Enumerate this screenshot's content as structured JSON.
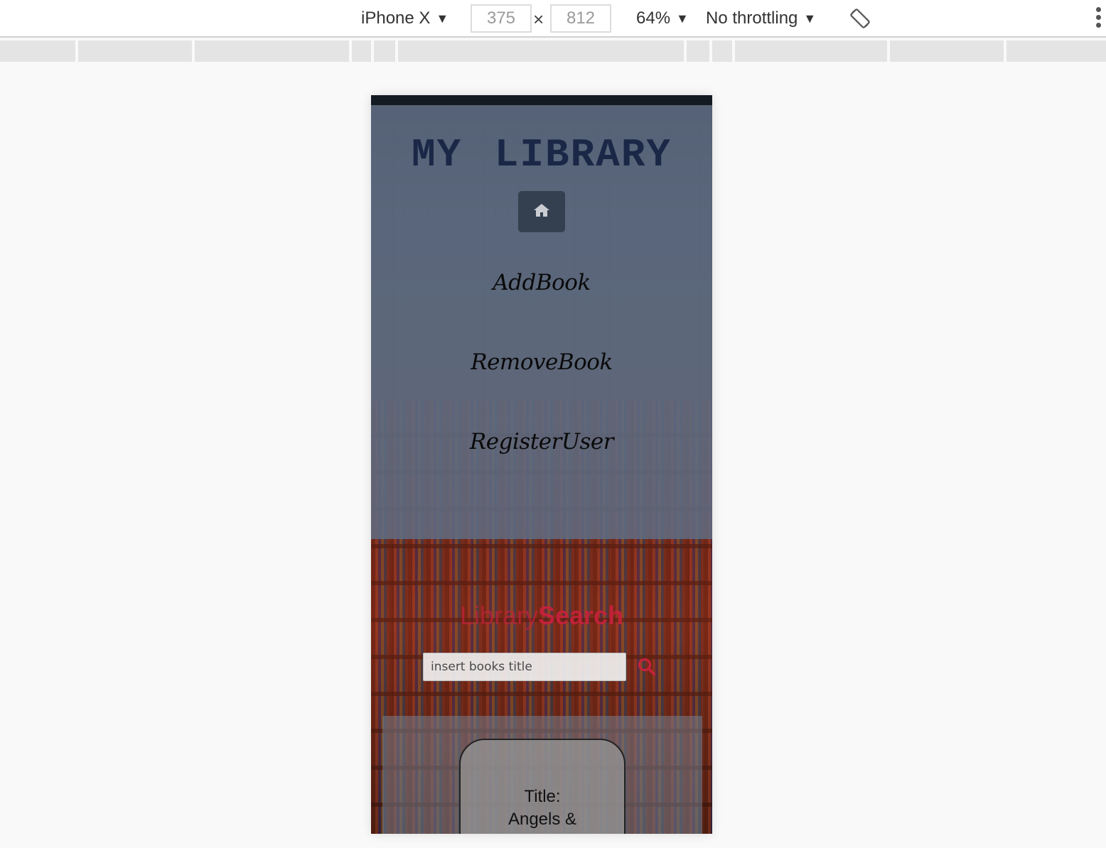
{
  "devtools": {
    "device": "iPhone X",
    "width": "375",
    "height": "812",
    "zoom": "64%",
    "throttling": "No throttling",
    "times_symbol": "×",
    "caret": "▼"
  },
  "app": {
    "title": "MY LIBRARY",
    "nav": {
      "add": "AddBook",
      "remove": "RemoveBook",
      "register": "RegisterUser"
    },
    "search": {
      "title_part1": "Library",
      "title_part2": "Search",
      "placeholder": "insert books title"
    },
    "result": {
      "line1": "Title:",
      "line2": "Angels &"
    }
  },
  "colors": {
    "title": "#1b2746",
    "search_accent": "#c8213c",
    "home_button": "#34404f"
  }
}
